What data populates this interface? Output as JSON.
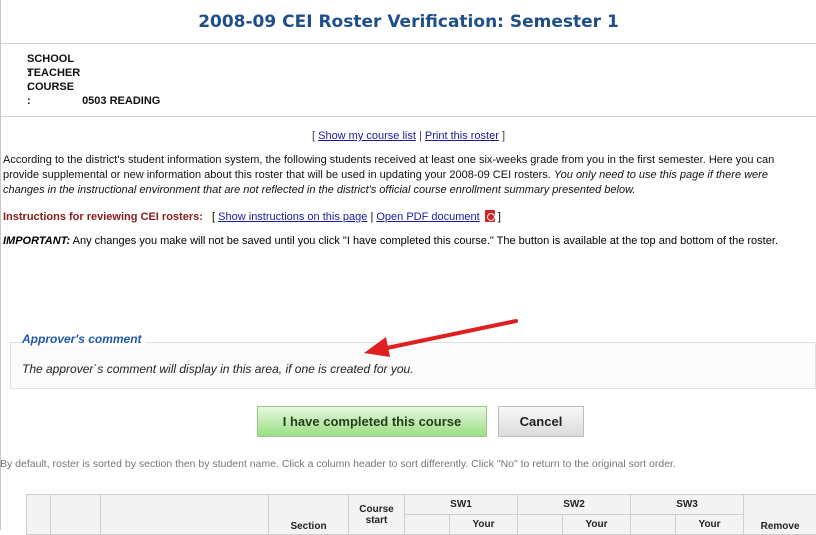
{
  "page": {
    "title": "2008-09 CEI Roster Verification: Semester 1"
  },
  "info": {
    "school_label": "SCHOOL :",
    "school_value": "",
    "teacher_label": "TEACHER :",
    "teacher_value": "",
    "course_label": "COURSE :",
    "course_value": "0503 READING"
  },
  "links": {
    "open_bracket": "[",
    "show_course_list": "Show my course list",
    "separator": "|",
    "print_roster": "Print this roster",
    "close_bracket": "]"
  },
  "intro": {
    "text": "According to the district's student information system, the following students received at least one six-weeks grade from you in the first semester. Here you can provide supplemental or new information about this roster that will be used in updating your 2008-09 CEI rosters.",
    "italic": "You only need to use this page if there were changes in the instructional environment that are not reflected in the district's official course enrollment summary presented below."
  },
  "instructions": {
    "label": "Instructions for reviewing CEI rosters:",
    "open_bracket": "[",
    "show_instructions": "Show instructions on this page",
    "separator": "|",
    "open_pdf": "Open PDF document",
    "close_bracket": "]"
  },
  "important": {
    "label": "IMPORTANT:",
    "text": "Any changes you make will not be saved until you click \"I have completed this course.\" The button is available at the top and bottom of the roster."
  },
  "comment": {
    "legend": "Approver's comment",
    "text": "The approver`s comment will display in this area, if one is created for you."
  },
  "buttons": {
    "complete": "I have completed this course",
    "cancel": "Cancel"
  },
  "sort_note": "By default, roster is sorted by section then by student name. Click a column header to sort differently. Click \"No\" to return to the original sort order.",
  "table": {
    "headers": {
      "section": "Section",
      "course_start_1": "Course",
      "course_start_2": "start",
      "sw1": "SW1",
      "sw2": "SW2",
      "sw3": "SW3",
      "your1": "Your",
      "your2": "Your",
      "your3": "Your",
      "remove": "Remove"
    }
  },
  "colors": {
    "title": "#1f4e8c",
    "instructions_label": "#8b1a1a",
    "comment_legend": "#1f5aa8",
    "primary_button": "#9adf84",
    "arrow": "#e02020"
  },
  "icons": {
    "pdf": "pdf-icon",
    "arrow": "red-arrow-annotation"
  }
}
